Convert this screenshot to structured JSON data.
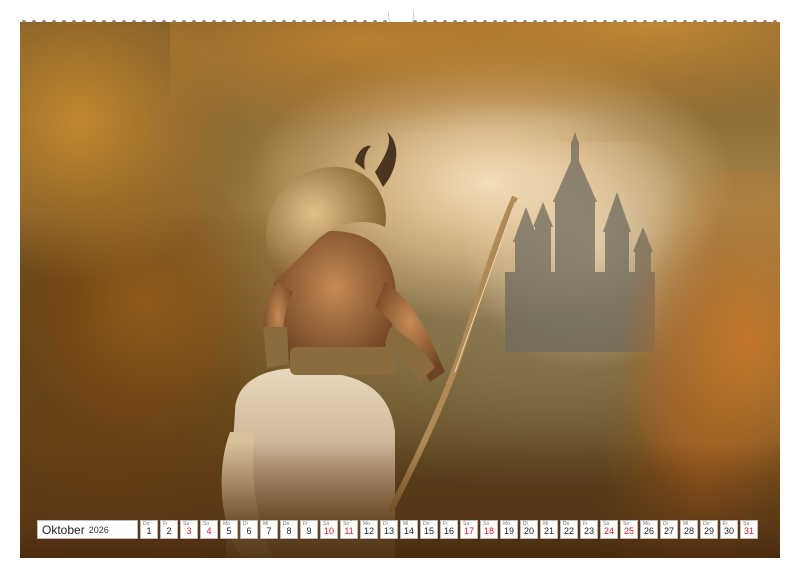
{
  "calendar": {
    "month": "Oktober",
    "year": "2026",
    "weekend_color": "#d0202a",
    "days": [
      {
        "num": "1",
        "dn": "Do",
        "weekend": false
      },
      {
        "num": "2",
        "dn": "Fr",
        "weekend": false
      },
      {
        "num": "3",
        "dn": "Sa",
        "weekend": true
      },
      {
        "num": "4",
        "dn": "So",
        "weekend": true
      },
      {
        "num": "5",
        "dn": "Mo",
        "weekend": false
      },
      {
        "num": "6",
        "dn": "Di",
        "weekend": false
      },
      {
        "num": "7",
        "dn": "Mi",
        "weekend": false
      },
      {
        "num": "8",
        "dn": "Do",
        "weekend": false
      },
      {
        "num": "9",
        "dn": "Fr",
        "weekend": false
      },
      {
        "num": "10",
        "dn": "Sa",
        "weekend": true
      },
      {
        "num": "11",
        "dn": "So",
        "weekend": true
      },
      {
        "num": "12",
        "dn": "Mo",
        "weekend": false
      },
      {
        "num": "13",
        "dn": "Di",
        "weekend": false
      },
      {
        "num": "14",
        "dn": "Mi",
        "weekend": false
      },
      {
        "num": "15",
        "dn": "Do",
        "weekend": false
      },
      {
        "num": "16",
        "dn": "Fr",
        "weekend": false
      },
      {
        "num": "17",
        "dn": "Sa",
        "weekend": true
      },
      {
        "num": "18",
        "dn": "So",
        "weekend": true
      },
      {
        "num": "19",
        "dn": "Mo",
        "weekend": false
      },
      {
        "num": "20",
        "dn": "Di",
        "weekend": false
      },
      {
        "num": "21",
        "dn": "Mi",
        "weekend": false
      },
      {
        "num": "22",
        "dn": "Do",
        "weekend": false
      },
      {
        "num": "23",
        "dn": "Fr",
        "weekend": false
      },
      {
        "num": "24",
        "dn": "Sa",
        "weekend": true
      },
      {
        "num": "25",
        "dn": "So",
        "weekend": true
      },
      {
        "num": "26",
        "dn": "Mo",
        "weekend": false
      },
      {
        "num": "27",
        "dn": "Di",
        "weekend": false
      },
      {
        "num": "28",
        "dn": "Mi",
        "weekend": false
      },
      {
        "num": "29",
        "dn": "Do",
        "weekend": false
      },
      {
        "num": "30",
        "dn": "Fr",
        "weekend": false
      },
      {
        "num": "31",
        "dn": "Sa",
        "weekend": true
      }
    ]
  },
  "photo": {
    "subject_icon": "centaur-archer-figure",
    "background_icon": "castle-silhouette",
    "palette": [
      "#7a5a28",
      "#c0862e",
      "#f3dfb9",
      "#3e2a10"
    ]
  }
}
